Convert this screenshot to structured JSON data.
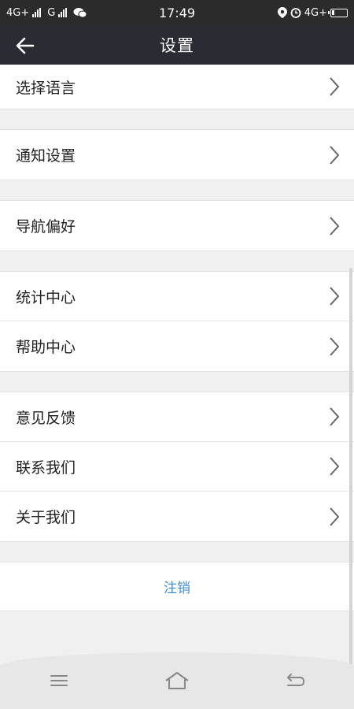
{
  "status_bar": {
    "network1": "4G+",
    "network2": "G",
    "time": "17:49",
    "network_right": "4G+"
  },
  "header": {
    "title": "设置",
    "back_icon": "arrow-left-icon"
  },
  "groups": [
    {
      "items": [
        {
          "label": "选择语言"
        }
      ]
    },
    {
      "items": [
        {
          "label": "通知设置"
        }
      ]
    },
    {
      "items": [
        {
          "label": "导航偏好"
        }
      ]
    },
    {
      "items": [
        {
          "label": "统计中心"
        },
        {
          "label": "帮助中心"
        }
      ]
    },
    {
      "items": [
        {
          "label": "意见反馈"
        },
        {
          "label": "联系我们"
        },
        {
          "label": "关于我们"
        }
      ]
    }
  ],
  "logout": {
    "label": "注销"
  },
  "colors": {
    "header_bg": "#2b2b33",
    "status_bg": "#2b2b2b",
    "logout_text": "#3f8fd0",
    "background": "#f0f0f0"
  },
  "nav_bar": {
    "menu_icon": "menu-icon",
    "home_icon": "home-icon",
    "back_icon": "back-icon"
  }
}
